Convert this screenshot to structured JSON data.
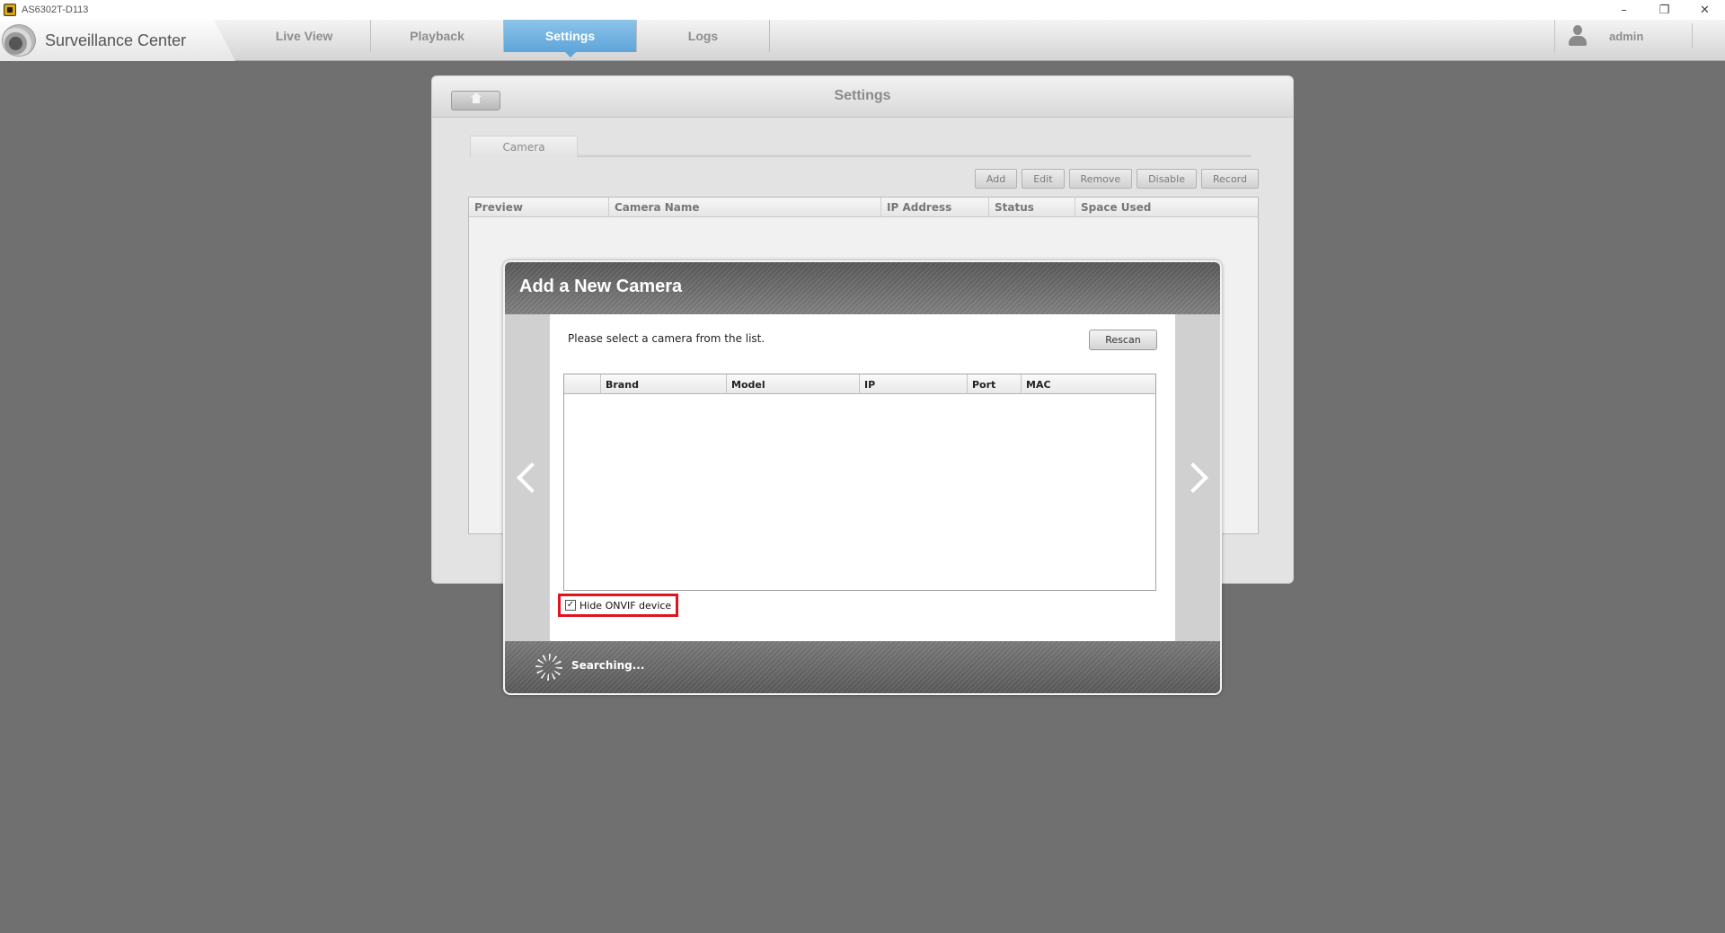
{
  "window": {
    "title": "AS6302T-D113",
    "controls": [
      "–",
      "❐",
      "✕"
    ]
  },
  "app": {
    "brand": "Surveillance Center",
    "tabs": [
      {
        "label": "Live View",
        "active": false
      },
      {
        "label": "Playback",
        "active": false
      },
      {
        "label": "Settings",
        "active": true
      },
      {
        "label": "Logs",
        "active": false
      }
    ],
    "user": "admin"
  },
  "settings": {
    "title": "Settings",
    "subtab": "Camera",
    "toolbar": [
      "Add",
      "Edit",
      "Remove",
      "Disable",
      "Record"
    ],
    "columns": [
      "Preview",
      "Camera Name",
      "IP Address",
      "Status",
      "Space Used"
    ]
  },
  "modal": {
    "title": "Add a New Camera",
    "instruction": "Please select a camera from the list.",
    "rescan_label": "Rescan",
    "columns": [
      "",
      "Brand",
      "Model",
      "IP",
      "Port",
      "MAC"
    ],
    "hide_onvif": {
      "label": "Hide ONVIF device",
      "checked": true,
      "mark": "✓"
    },
    "status": "Searching..."
  },
  "colors": {
    "accent": "#5ea5d9",
    "highlight": "#e0141e",
    "backdrop": "#707070"
  }
}
